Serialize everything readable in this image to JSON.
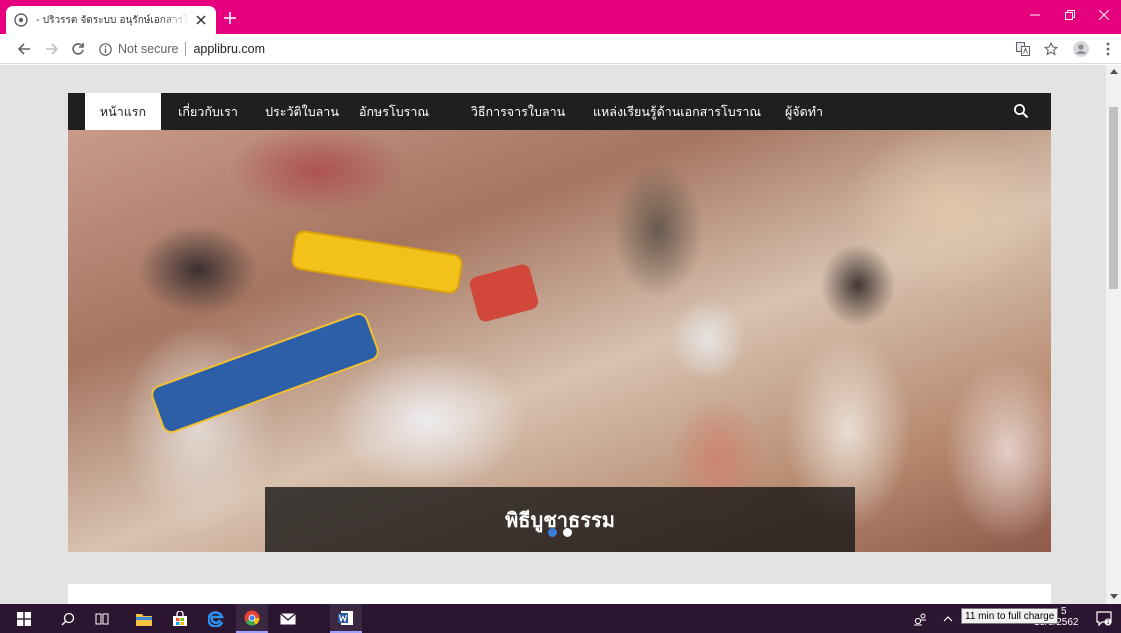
{
  "browser": {
    "tab_title": "- ปริวรรต จัดระบบ อนุรักษ์เอกสารใบลาน",
    "address": {
      "security_label": "Not secure",
      "url": "applibru.com"
    }
  },
  "site": {
    "nav_items": [
      {
        "label": "หน้าแรก",
        "active": true
      },
      {
        "label": "เกี่ยวกับเรา",
        "active": false
      },
      {
        "label": "ประวัติใบลาน",
        "active": false
      },
      {
        "label": "อักษรโบราณ",
        "active": false
      },
      {
        "label": "วิธีการจารใบลาน",
        "active": false
      },
      {
        "label": "แหล่งเรียนรู้ด้านเอกสารโบราณ",
        "active": false
      },
      {
        "label": "ผู้จัดทำ",
        "active": false
      }
    ],
    "hero": {
      "caption": "พิธีบูชาธรรม",
      "slides": 2,
      "active_slide": 1
    }
  },
  "taskbar": {
    "tooltip": "11 min to full charge",
    "date": "13/8/2562",
    "time_fragment": "5"
  },
  "colors": {
    "titlebar": "#e6007e",
    "site_nav": "#1f1f1f",
    "page_bg": "#e3e3e3",
    "taskbar": "#2c1530",
    "dot_active": "#3b7dd8",
    "dot_inactive": "#ffffff"
  }
}
